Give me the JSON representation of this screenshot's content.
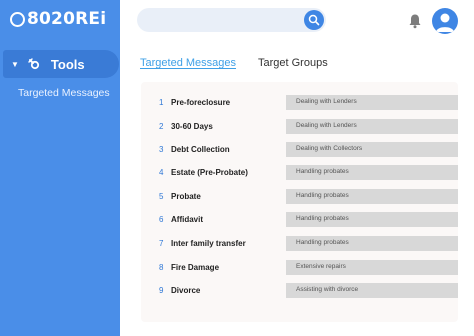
{
  "brand": {
    "logo_text": "8020REi"
  },
  "sidebar": {
    "section_label": "Tools",
    "items": [
      {
        "label": "Targeted Messages"
      }
    ]
  },
  "header": {
    "search_placeholder": "",
    "icons": [
      "search-icon",
      "bell-icon",
      "user-avatar-icon"
    ]
  },
  "tabs": [
    {
      "label": "Targeted Messages",
      "active": true
    },
    {
      "label": "Target Groups",
      "active": false
    }
  ],
  "messages": [
    {
      "num": "1",
      "name": "Pre-foreclosure",
      "tag": "Dealing with Lenders"
    },
    {
      "num": "2",
      "name": "30-60 Days",
      "tag": "Dealing with Lenders"
    },
    {
      "num": "3",
      "name": "Debt Collection",
      "tag": "Dealing with Collectors"
    },
    {
      "num": "4",
      "name": "Estate (Pre-Probate)",
      "tag": "Handling probates"
    },
    {
      "num": "5",
      "name": "Probate",
      "tag": "Handling probates"
    },
    {
      "num": "6",
      "name": "Affidavit",
      "tag": "Handling probates"
    },
    {
      "num": "7",
      "name": "Inter family transfer",
      "tag": "Handling probates"
    },
    {
      "num": "8",
      "name": "Fire Damage",
      "tag": "Extensive repairs"
    },
    {
      "num": "9",
      "name": "Divorce",
      "tag": "Assisting with divorce"
    }
  ],
  "colors": {
    "sidebar": "#4a8ee8",
    "accent": "#3f86e4",
    "tab_active": "#3fa0e6",
    "panel": "#fbf8f7",
    "tag_bg": "#d8d8d8"
  }
}
